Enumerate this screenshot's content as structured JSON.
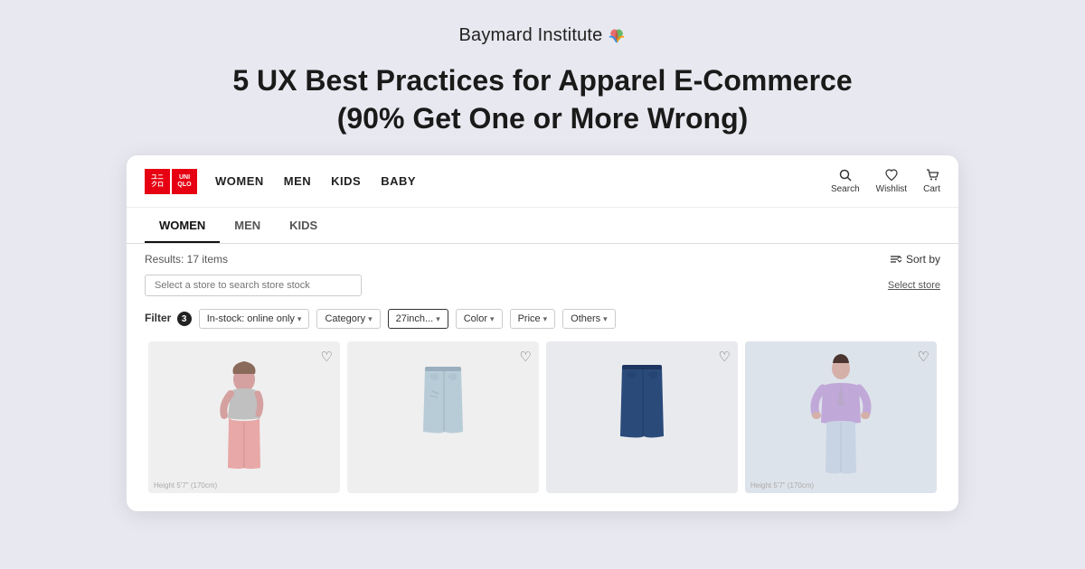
{
  "brand": {
    "name": "Baymard Institute",
    "logo_icon": "✦"
  },
  "page_title": "5 UX Best Practices for Apparel E-Commerce (90% Get One or More Wrong)",
  "uniqlo": {
    "logo_left": "ユニ\nクロ",
    "logo_right": "UNI\nQLO",
    "nav_links": [
      "WOMEN",
      "MEN",
      "KIDS",
      "BABY"
    ],
    "nav_actions": [
      {
        "label": "Search",
        "icon": "🔍"
      },
      {
        "label": "Wishlist",
        "icon": "♡"
      },
      {
        "label": "Cart",
        "icon": "🛒"
      }
    ]
  },
  "sub_tabs": [
    {
      "label": "WOMEN",
      "active": true
    },
    {
      "label": "MEN",
      "active": false
    },
    {
      "label": "KIDS",
      "active": false
    }
  ],
  "results": {
    "label": "Results: 17 items"
  },
  "sort": {
    "label": "Sort by"
  },
  "store_search": {
    "placeholder": "Select a store to search store stock",
    "link": "Select store"
  },
  "filters": {
    "label": "Filter",
    "badge": "3",
    "chips": [
      {
        "label": "In-stock: online only",
        "chevron": "▾"
      },
      {
        "label": "Category",
        "chevron": "▾"
      },
      {
        "label": "27inch...",
        "chevron": "▾"
      },
      {
        "label": "Color",
        "chevron": "▾"
      },
      {
        "label": "Price",
        "chevron": "▾"
      },
      {
        "label": "Others",
        "chevron": "▾"
      }
    ]
  },
  "products": [
    {
      "bg": "#f0edec",
      "height_label": "Height 5'7\" (170cm)",
      "figure_color": "#e8a0a8",
      "pants_color": "#f4c0c0",
      "top_color": "#c8c8c8"
    },
    {
      "bg": "#efefef",
      "height_label": "",
      "figure_color": "#a8b4c0",
      "pants_color": "#b8c8d8"
    },
    {
      "bg": "#e8eaee",
      "height_label": "",
      "figure_color": "#3a5a8a",
      "pants_color": "#2a4a7a"
    },
    {
      "bg": "#d8dde8",
      "height_label": "Height 5'7\" (170cm)",
      "figure_color": "#c8b0c8",
      "jacket_color": "#c8b0c8"
    }
  ]
}
